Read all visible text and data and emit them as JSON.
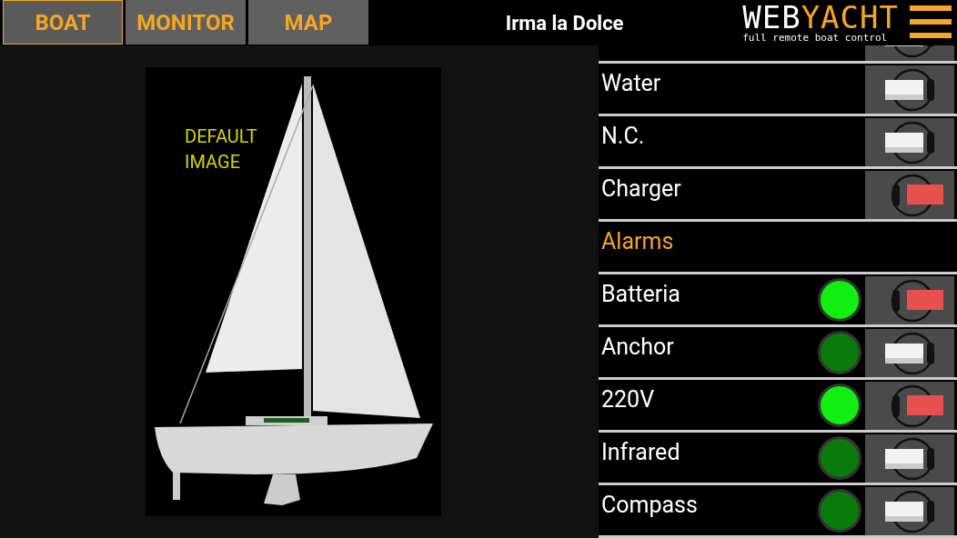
{
  "tabs": [
    {
      "label": "BOAT",
      "selected": true
    },
    {
      "label": "MONITOR",
      "selected": false
    },
    {
      "label": "MAP",
      "selected": false
    }
  ],
  "title": "Irma la Dolce",
  "logo": {
    "part1": "WEB",
    "part2": "YACHT",
    "tagline": "full remote boat control"
  },
  "boat_image": {
    "caption_line1": "DEFAULT",
    "caption_line2": "IMAGE"
  },
  "rows": [
    {
      "kind": "partial",
      "on": false
    },
    {
      "kind": "switch",
      "label": "Water",
      "on": false
    },
    {
      "kind": "switch",
      "label": "N.C.",
      "on": false
    },
    {
      "kind": "switch",
      "label": "Charger",
      "on": true
    },
    {
      "kind": "header",
      "label": "Alarms"
    },
    {
      "kind": "alarm",
      "label": "Batteria",
      "lit": true,
      "on": true
    },
    {
      "kind": "alarm",
      "label": "Anchor",
      "lit": false,
      "on": false
    },
    {
      "kind": "alarm",
      "label": "220V",
      "lit": true,
      "on": true
    },
    {
      "kind": "alarm",
      "label": "Infrared",
      "lit": false,
      "on": false
    },
    {
      "kind": "alarm",
      "label": "Compass",
      "lit": false,
      "on": false
    }
  ]
}
